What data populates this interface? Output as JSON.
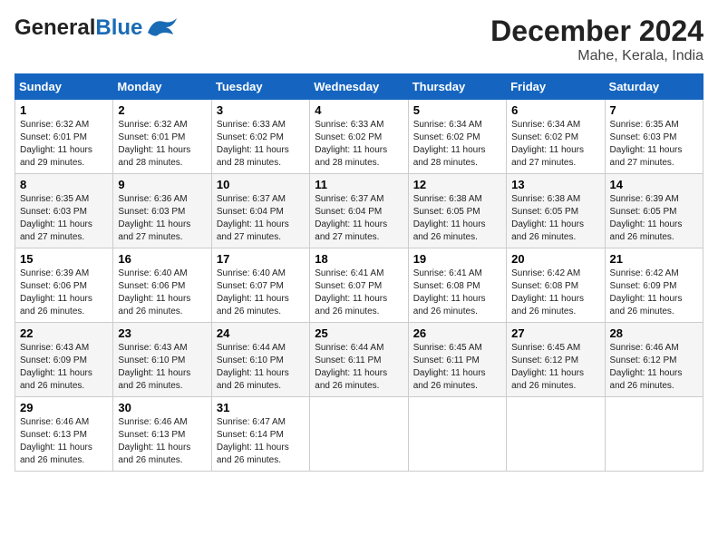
{
  "header": {
    "logo_general": "General",
    "logo_blue": "Blue",
    "month_title": "December 2024",
    "location": "Mahe, Kerala, India"
  },
  "weekdays": [
    "Sunday",
    "Monday",
    "Tuesday",
    "Wednesday",
    "Thursday",
    "Friday",
    "Saturday"
  ],
  "weeks": [
    [
      {
        "day": "1",
        "sunrise": "Sunrise: 6:32 AM",
        "sunset": "Sunset: 6:01 PM",
        "daylight": "Daylight: 11 hours and 29 minutes."
      },
      {
        "day": "2",
        "sunrise": "Sunrise: 6:32 AM",
        "sunset": "Sunset: 6:01 PM",
        "daylight": "Daylight: 11 hours and 28 minutes."
      },
      {
        "day": "3",
        "sunrise": "Sunrise: 6:33 AM",
        "sunset": "Sunset: 6:02 PM",
        "daylight": "Daylight: 11 hours and 28 minutes."
      },
      {
        "day": "4",
        "sunrise": "Sunrise: 6:33 AM",
        "sunset": "Sunset: 6:02 PM",
        "daylight": "Daylight: 11 hours and 28 minutes."
      },
      {
        "day": "5",
        "sunrise": "Sunrise: 6:34 AM",
        "sunset": "Sunset: 6:02 PM",
        "daylight": "Daylight: 11 hours and 28 minutes."
      },
      {
        "day": "6",
        "sunrise": "Sunrise: 6:34 AM",
        "sunset": "Sunset: 6:02 PM",
        "daylight": "Daylight: 11 hours and 27 minutes."
      },
      {
        "day": "7",
        "sunrise": "Sunrise: 6:35 AM",
        "sunset": "Sunset: 6:03 PM",
        "daylight": "Daylight: 11 hours and 27 minutes."
      }
    ],
    [
      {
        "day": "8",
        "sunrise": "Sunrise: 6:35 AM",
        "sunset": "Sunset: 6:03 PM",
        "daylight": "Daylight: 11 hours and 27 minutes."
      },
      {
        "day": "9",
        "sunrise": "Sunrise: 6:36 AM",
        "sunset": "Sunset: 6:03 PM",
        "daylight": "Daylight: 11 hours and 27 minutes."
      },
      {
        "day": "10",
        "sunrise": "Sunrise: 6:37 AM",
        "sunset": "Sunset: 6:04 PM",
        "daylight": "Daylight: 11 hours and 27 minutes."
      },
      {
        "day": "11",
        "sunrise": "Sunrise: 6:37 AM",
        "sunset": "Sunset: 6:04 PM",
        "daylight": "Daylight: 11 hours and 27 minutes."
      },
      {
        "day": "12",
        "sunrise": "Sunrise: 6:38 AM",
        "sunset": "Sunset: 6:05 PM",
        "daylight": "Daylight: 11 hours and 26 minutes."
      },
      {
        "day": "13",
        "sunrise": "Sunrise: 6:38 AM",
        "sunset": "Sunset: 6:05 PM",
        "daylight": "Daylight: 11 hours and 26 minutes."
      },
      {
        "day": "14",
        "sunrise": "Sunrise: 6:39 AM",
        "sunset": "Sunset: 6:05 PM",
        "daylight": "Daylight: 11 hours and 26 minutes."
      }
    ],
    [
      {
        "day": "15",
        "sunrise": "Sunrise: 6:39 AM",
        "sunset": "Sunset: 6:06 PM",
        "daylight": "Daylight: 11 hours and 26 minutes."
      },
      {
        "day": "16",
        "sunrise": "Sunrise: 6:40 AM",
        "sunset": "Sunset: 6:06 PM",
        "daylight": "Daylight: 11 hours and 26 minutes."
      },
      {
        "day": "17",
        "sunrise": "Sunrise: 6:40 AM",
        "sunset": "Sunset: 6:07 PM",
        "daylight": "Daylight: 11 hours and 26 minutes."
      },
      {
        "day": "18",
        "sunrise": "Sunrise: 6:41 AM",
        "sunset": "Sunset: 6:07 PM",
        "daylight": "Daylight: 11 hours and 26 minutes."
      },
      {
        "day": "19",
        "sunrise": "Sunrise: 6:41 AM",
        "sunset": "Sunset: 6:08 PM",
        "daylight": "Daylight: 11 hours and 26 minutes."
      },
      {
        "day": "20",
        "sunrise": "Sunrise: 6:42 AM",
        "sunset": "Sunset: 6:08 PM",
        "daylight": "Daylight: 11 hours and 26 minutes."
      },
      {
        "day": "21",
        "sunrise": "Sunrise: 6:42 AM",
        "sunset": "Sunset: 6:09 PM",
        "daylight": "Daylight: 11 hours and 26 minutes."
      }
    ],
    [
      {
        "day": "22",
        "sunrise": "Sunrise: 6:43 AM",
        "sunset": "Sunset: 6:09 PM",
        "daylight": "Daylight: 11 hours and 26 minutes."
      },
      {
        "day": "23",
        "sunrise": "Sunrise: 6:43 AM",
        "sunset": "Sunset: 6:10 PM",
        "daylight": "Daylight: 11 hours and 26 minutes."
      },
      {
        "day": "24",
        "sunrise": "Sunrise: 6:44 AM",
        "sunset": "Sunset: 6:10 PM",
        "daylight": "Daylight: 11 hours and 26 minutes."
      },
      {
        "day": "25",
        "sunrise": "Sunrise: 6:44 AM",
        "sunset": "Sunset: 6:11 PM",
        "daylight": "Daylight: 11 hours and 26 minutes."
      },
      {
        "day": "26",
        "sunrise": "Sunrise: 6:45 AM",
        "sunset": "Sunset: 6:11 PM",
        "daylight": "Daylight: 11 hours and 26 minutes."
      },
      {
        "day": "27",
        "sunrise": "Sunrise: 6:45 AM",
        "sunset": "Sunset: 6:12 PM",
        "daylight": "Daylight: 11 hours and 26 minutes."
      },
      {
        "day": "28",
        "sunrise": "Sunrise: 6:46 AM",
        "sunset": "Sunset: 6:12 PM",
        "daylight": "Daylight: 11 hours and 26 minutes."
      }
    ],
    [
      {
        "day": "29",
        "sunrise": "Sunrise: 6:46 AM",
        "sunset": "Sunset: 6:13 PM",
        "daylight": "Daylight: 11 hours and 26 minutes."
      },
      {
        "day": "30",
        "sunrise": "Sunrise: 6:46 AM",
        "sunset": "Sunset: 6:13 PM",
        "daylight": "Daylight: 11 hours and 26 minutes."
      },
      {
        "day": "31",
        "sunrise": "Sunrise: 6:47 AM",
        "sunset": "Sunset: 6:14 PM",
        "daylight": "Daylight: 11 hours and 26 minutes."
      },
      null,
      null,
      null,
      null
    ]
  ]
}
